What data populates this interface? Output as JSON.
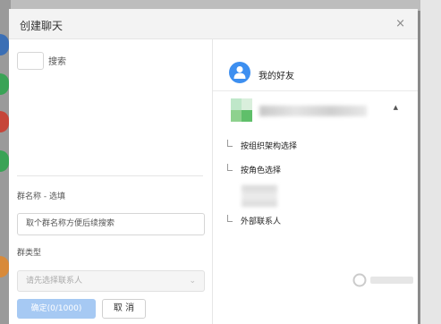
{
  "modal": {
    "title": "创建聊天",
    "close_glyph": "×"
  },
  "left": {
    "search_label": "搜索",
    "group_name_label": "群名称 - 选填",
    "group_name_placeholder": "取个群名称方便后续搜索",
    "group_type_label": "群类型",
    "group_type_placeholder": "请先选择联系人",
    "confirm_label": "确定(0/1000)",
    "cancel_label": "取 消"
  },
  "right": {
    "friends_label": "我的好友",
    "tree_items": [
      {
        "label": "按组织架构选择"
      },
      {
        "label": "按角色选择"
      },
      {
        "label": "外部联系人"
      }
    ]
  },
  "icons": {
    "close": "close-icon",
    "chevron": "chevron-down-icon",
    "caret": "caret-up-icon",
    "user": "user-icon"
  },
  "colors": {
    "accent": "#3d8ff0",
    "confirm_disabled": "#a6c9f3",
    "header_bg": "#f3f3f3"
  }
}
